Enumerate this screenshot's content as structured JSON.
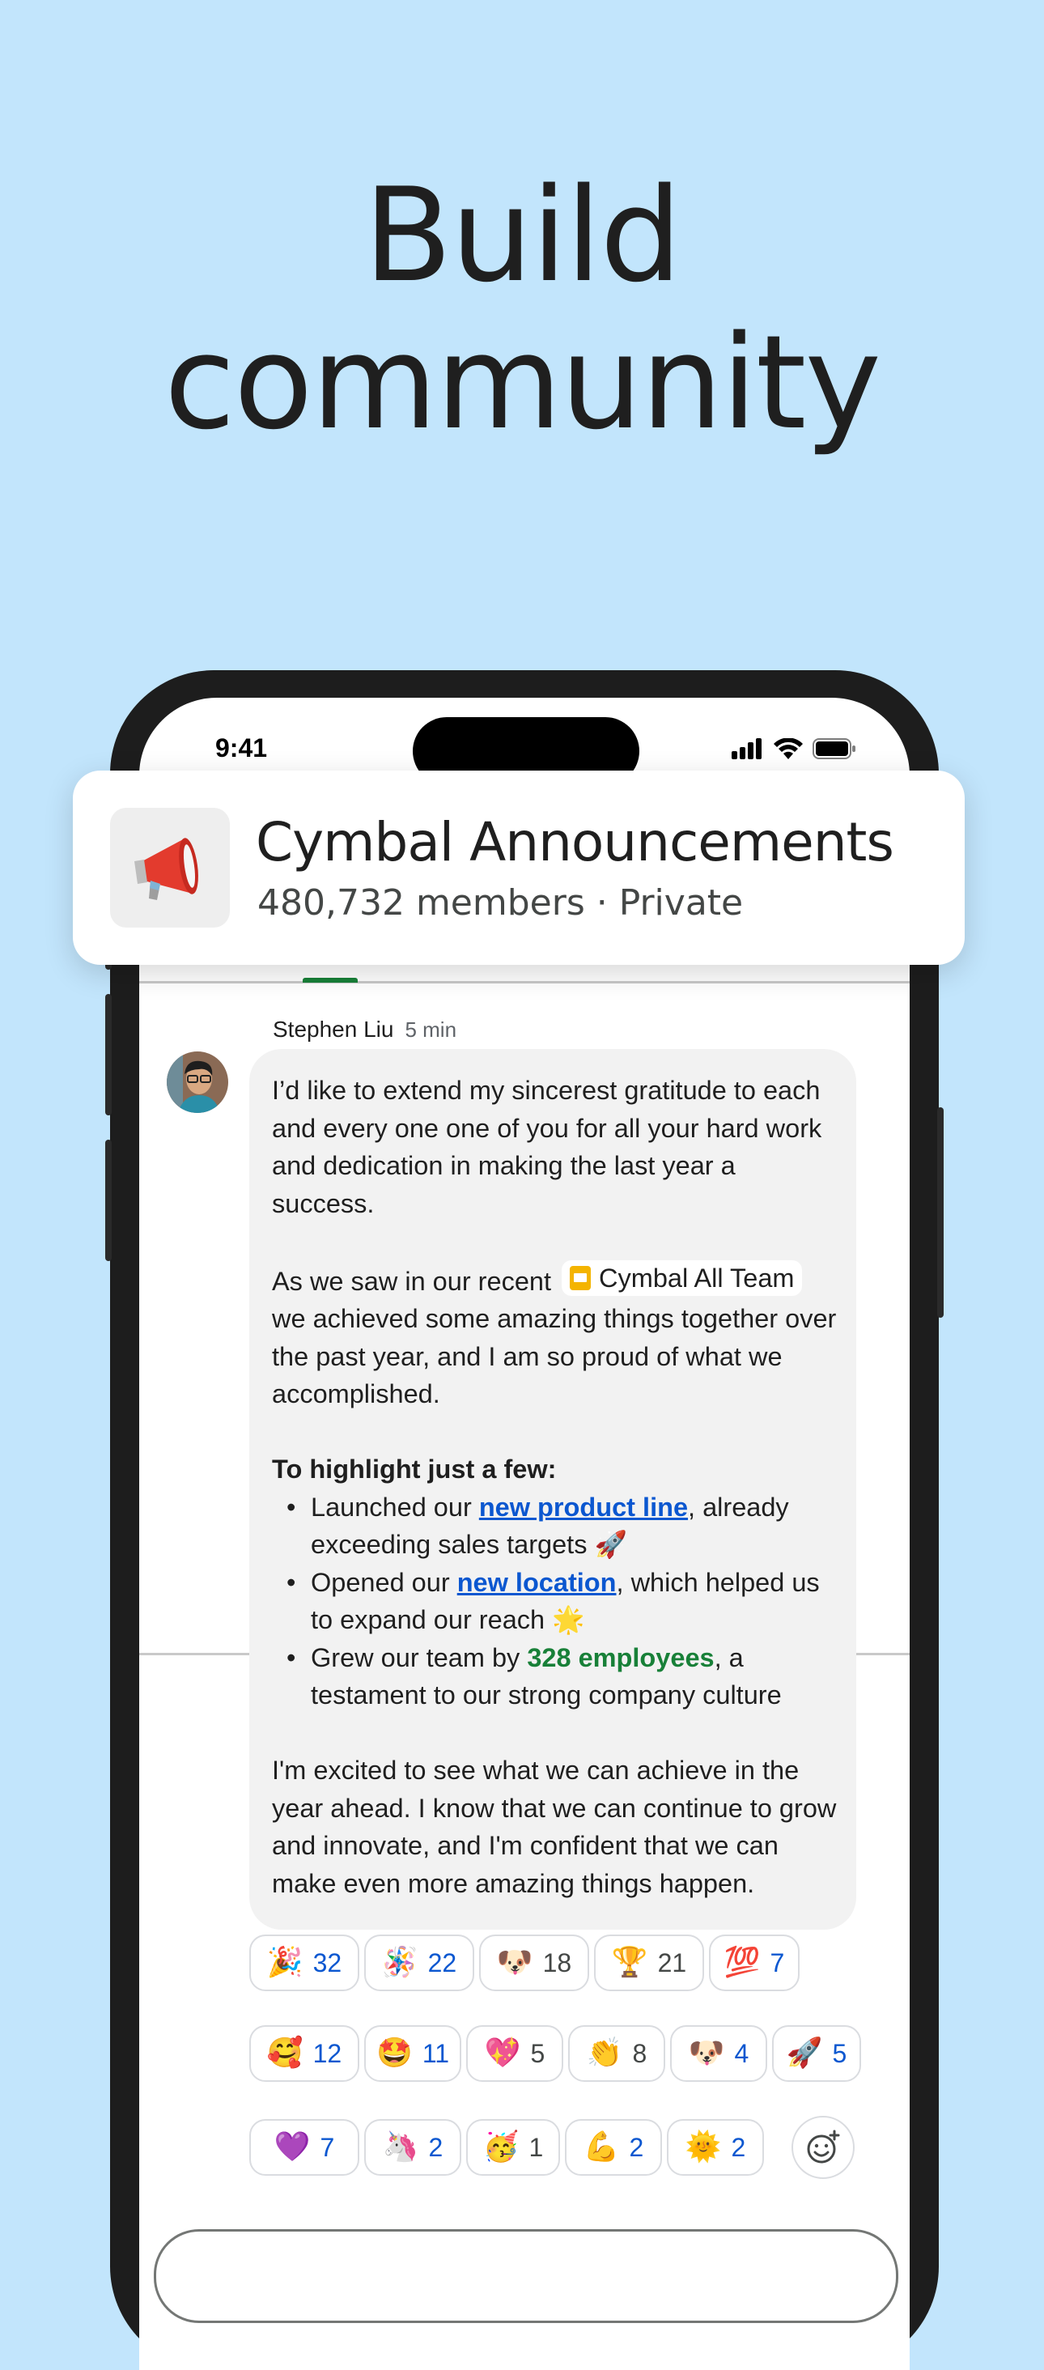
{
  "headline": {
    "line1": "Build",
    "line2": "community"
  },
  "status_bar": {
    "time": "9:41"
  },
  "group": {
    "name": "Cymbal Announcements",
    "meta": "480,732 members · Private",
    "icon": "megaphone-icon"
  },
  "message": {
    "sender": "Stephen Liu",
    "time": "5 min",
    "p1": "I’d like to extend my sincerest gratitude to each and every one one of you for all your hard work and dedication in making the last year a success.",
    "p2_before": "As we saw in our recent",
    "p2_chip": "Cymbal All Team",
    "p2_after": "we achieved some amazing things together over the past year, and I am so proud of what we accomplished.",
    "highlight_title": "To highlight just a few:",
    "bullets": [
      {
        "pre": "Launched our ",
        "em": "new product line",
        "post": ", already exceeding sales targets 🚀"
      },
      {
        "pre": "Opened our ",
        "em": "new location",
        "post": ", which helped us to expand our reach 🌟"
      },
      {
        "pre": "Grew our team by ",
        "em": "328 employees",
        "post": ", a testament to our strong company culture"
      }
    ],
    "closing": "I'm excited to see what we can achieve in the year ahead. I know that we can continue to grow and innovate, and I'm confident that we can make even more amazing things happen."
  },
  "reactions": [
    {
      "emoji": "🎉",
      "count": "32",
      "mine": true
    },
    {
      "emoji": "🪅",
      "count": "22",
      "mine": true
    },
    {
      "emoji": "🐶",
      "count": "18",
      "mine": false
    },
    {
      "emoji": "🏆",
      "count": "21",
      "mine": false
    },
    {
      "emoji": "💯",
      "count": "7",
      "mine": true
    },
    {
      "emoji": "🥰",
      "count": "12",
      "mine": true
    },
    {
      "emoji": "🤩",
      "count": "11",
      "mine": true
    },
    {
      "emoji": "💖",
      "count": "5",
      "mine": false
    },
    {
      "emoji": "👏",
      "count": "8",
      "mine": false
    },
    {
      "emoji": "🐶",
      "count": "4",
      "mine": true
    },
    {
      "emoji": "🚀",
      "count": "5",
      "mine": true
    },
    {
      "emoji": "💜",
      "count": "7",
      "mine": true
    },
    {
      "emoji": "🦄",
      "count": "2",
      "mine": true
    },
    {
      "emoji": "🥳",
      "count": "1",
      "mine": false
    },
    {
      "emoji": "💪",
      "count": "2",
      "mine": true
    },
    {
      "emoji": "🌞",
      "count": "2",
      "mine": true
    }
  ],
  "colors": {
    "background": "#c2e5fc",
    "link": "#0b57d0",
    "accent_green": "#188038"
  }
}
